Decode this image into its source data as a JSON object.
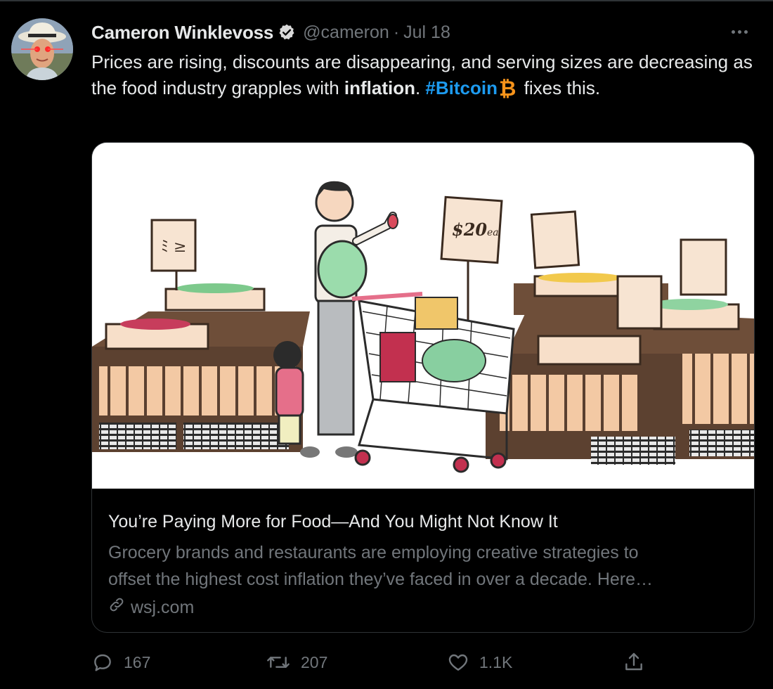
{
  "tweet": {
    "author_name": "Cameron Winklevoss",
    "handle": "@cameron",
    "separator": "·",
    "date": "Jul 18",
    "text_part1": "Prices are rising, discounts are disappearing, and serving sizes are decreasing as the food industry grapples with ",
    "text_bold": "inflation",
    "text_part2": ". ",
    "hashtag": "#Bitcoin",
    "bitcoin_emoji": "₿",
    "text_part3": " fixes this."
  },
  "card": {
    "image_sign_price": "$20",
    "image_sign_unit": "ea",
    "title": "You’re Paying More for Food—And You Might Not Know It",
    "description_line1": "Grocery brands and restaurants are employing creative strategies to",
    "description_line2": "offset the highest cost inflation they’ve faced in over a decade. Here…",
    "domain": "wsj.com"
  },
  "actions": {
    "reply_count": "167",
    "retweet_count": "207",
    "like_count": "1.1K"
  },
  "colors": {
    "background": "#000000",
    "text_primary": "#e7e9ea",
    "text_secondary": "#71767b",
    "link": "#1d9bf0",
    "bitcoin": "#f7931a",
    "border": "#2f3336"
  },
  "icons": [
    "verified-badge-icon",
    "more-options-icon",
    "link-icon",
    "reply-icon",
    "retweet-icon",
    "like-icon",
    "share-icon"
  ]
}
